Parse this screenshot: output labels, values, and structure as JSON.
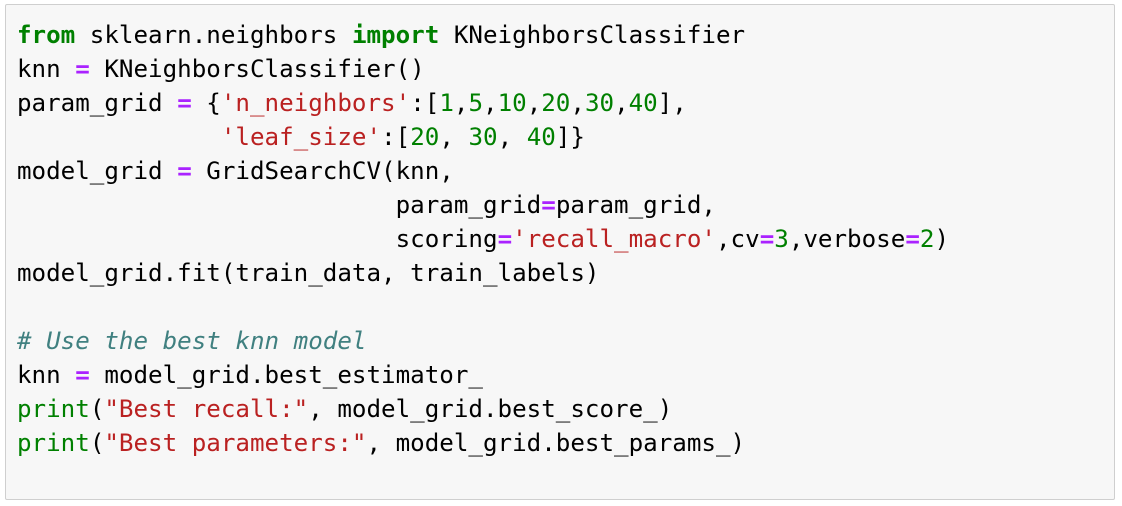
{
  "code": {
    "lines": [
      [
        {
          "text": "from",
          "type": "kw"
        },
        {
          "text": " sklearn.neighbors ",
          "type": "plain"
        },
        {
          "text": "import",
          "type": "kw"
        },
        {
          "text": " KNeighborsClassifier",
          "type": "plain"
        }
      ],
      [
        {
          "text": "knn ",
          "type": "plain"
        },
        {
          "text": "=",
          "type": "op"
        },
        {
          "text": " KNeighborsClassifier()",
          "type": "plain"
        }
      ],
      [
        {
          "text": "param_grid ",
          "type": "plain"
        },
        {
          "text": "=",
          "type": "op"
        },
        {
          "text": " {",
          "type": "plain"
        },
        {
          "text": "'n_neighbors'",
          "type": "str"
        },
        {
          "text": ":[",
          "type": "plain"
        },
        {
          "text": "1",
          "type": "num"
        },
        {
          "text": ",",
          "type": "plain"
        },
        {
          "text": "5",
          "type": "num"
        },
        {
          "text": ",",
          "type": "plain"
        },
        {
          "text": "10",
          "type": "num"
        },
        {
          "text": ",",
          "type": "plain"
        },
        {
          "text": "20",
          "type": "num"
        },
        {
          "text": ",",
          "type": "plain"
        },
        {
          "text": "30",
          "type": "num"
        },
        {
          "text": ",",
          "type": "plain"
        },
        {
          "text": "40",
          "type": "num"
        },
        {
          "text": "],",
          "type": "plain"
        }
      ],
      [
        {
          "text": "              ",
          "type": "plain"
        },
        {
          "text": "'leaf_size'",
          "type": "str"
        },
        {
          "text": ":[",
          "type": "plain"
        },
        {
          "text": "20",
          "type": "num"
        },
        {
          "text": ", ",
          "type": "plain"
        },
        {
          "text": "30",
          "type": "num"
        },
        {
          "text": ", ",
          "type": "plain"
        },
        {
          "text": "40",
          "type": "num"
        },
        {
          "text": "]}",
          "type": "plain"
        }
      ],
      [
        {
          "text": "model_grid ",
          "type": "plain"
        },
        {
          "text": "=",
          "type": "op"
        },
        {
          "text": " GridSearchCV(knn,",
          "type": "plain"
        }
      ],
      [
        {
          "text": "                          param_grid",
          "type": "plain"
        },
        {
          "text": "=",
          "type": "op"
        },
        {
          "text": "param_grid,",
          "type": "plain"
        }
      ],
      [
        {
          "text": "                          scoring",
          "type": "plain"
        },
        {
          "text": "=",
          "type": "op"
        },
        {
          "text": "'recall_macro'",
          "type": "str"
        },
        {
          "text": ",cv",
          "type": "plain"
        },
        {
          "text": "=",
          "type": "op"
        },
        {
          "text": "3",
          "type": "num"
        },
        {
          "text": ",verbose",
          "type": "plain"
        },
        {
          "text": "=",
          "type": "op"
        },
        {
          "text": "2",
          "type": "num"
        },
        {
          "text": ")",
          "type": "plain"
        }
      ],
      [
        {
          "text": "model_grid.fit(train_data, train_labels)",
          "type": "plain"
        }
      ],
      [],
      [
        {
          "text": "# Use the best knn model",
          "type": "cm"
        }
      ],
      [
        {
          "text": "knn ",
          "type": "plain"
        },
        {
          "text": "=",
          "type": "op"
        },
        {
          "text": " model_grid.best_estimator_",
          "type": "plain"
        }
      ],
      [
        {
          "text": "print",
          "type": "bi"
        },
        {
          "text": "(",
          "type": "plain"
        },
        {
          "text": "\"Best recall:\"",
          "type": "str"
        },
        {
          "text": ", model_grid.best_score_)",
          "type": "plain"
        }
      ],
      [
        {
          "text": "print",
          "type": "bi"
        },
        {
          "text": "(",
          "type": "plain"
        },
        {
          "text": "\"Best parameters:\"",
          "type": "str"
        },
        {
          "text": ", model_grid.best_params_)",
          "type": "plain"
        }
      ]
    ]
  },
  "colors": {
    "keyword": "#008000",
    "builtin": "#008000",
    "operator": "#aa22ff",
    "number": "#008000",
    "string": "#ba2121",
    "comment": "#408080",
    "background": "#f7f7f7",
    "border": "#cfcfcf"
  }
}
